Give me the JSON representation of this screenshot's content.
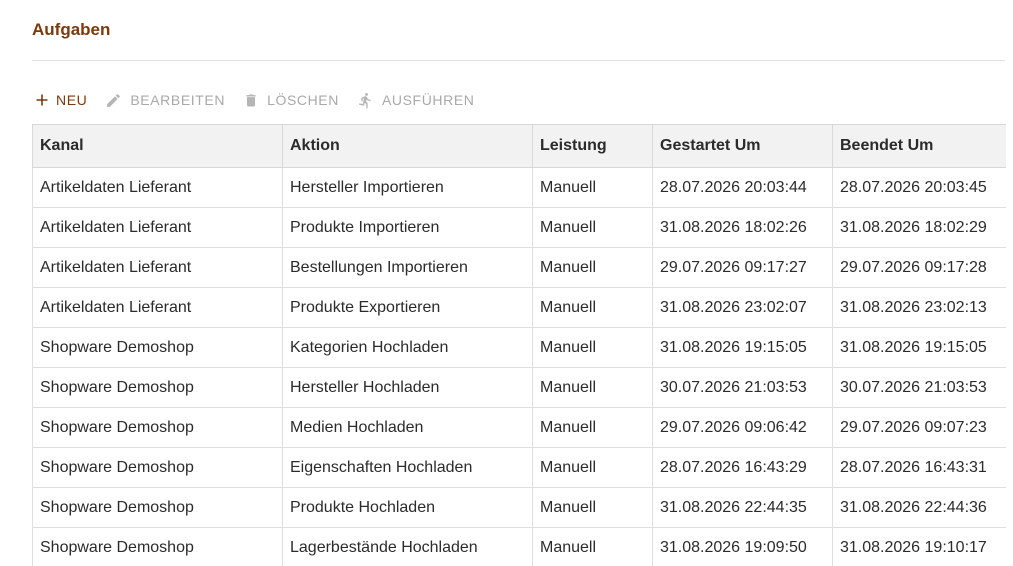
{
  "page": {
    "title": "Aufgaben"
  },
  "toolbar": {
    "new_label": "NEU",
    "edit_label": "BEARBEITEN",
    "delete_label": "LÖSCHEN",
    "run_label": "AUSFÜHREN"
  },
  "colors": {
    "accent": "#7a3a0c",
    "disabled": "#a9a9a9",
    "header_bg": "#f2f2f2"
  },
  "table": {
    "columns": [
      "Kanal",
      "Aktion",
      "Leistung",
      "Gestartet Um",
      "Beendet Um"
    ],
    "rows": [
      [
        "Artikeldaten Lieferant",
        "Hersteller Importieren",
        "Manuell",
        "28.07.2026 20:03:44",
        "28.07.2026 20:03:45"
      ],
      [
        "Artikeldaten Lieferant",
        "Produkte Importieren",
        "Manuell",
        "31.08.2026 18:02:26",
        "31.08.2026 18:02:29"
      ],
      [
        "Artikeldaten Lieferant",
        "Bestellungen Importieren",
        "Manuell",
        "29.07.2026 09:17:27",
        "29.07.2026 09:17:28"
      ],
      [
        "Artikeldaten Lieferant",
        "Produkte Exportieren",
        "Manuell",
        "31.08.2026 23:02:07",
        "31.08.2026 23:02:13"
      ],
      [
        "Shopware Demoshop",
        "Kategorien Hochladen",
        "Manuell",
        "31.08.2026 19:15:05",
        "31.08.2026 19:15:05"
      ],
      [
        "Shopware Demoshop",
        "Hersteller Hochladen",
        "Manuell",
        "30.07.2026 21:03:53",
        "30.07.2026 21:03:53"
      ],
      [
        "Shopware Demoshop",
        "Medien Hochladen",
        "Manuell",
        "29.07.2026 09:06:42",
        "29.07.2026 09:07:23"
      ],
      [
        "Shopware Demoshop",
        "Eigenschaften Hochladen",
        "Manuell",
        "28.07.2026 16:43:29",
        "28.07.2026 16:43:31"
      ],
      [
        "Shopware Demoshop",
        "Produkte Hochladen",
        "Manuell",
        "31.08.2026 22:44:35",
        "31.08.2026 22:44:36"
      ],
      [
        "Shopware Demoshop",
        "Lagerbestände Hochladen",
        "Manuell",
        "31.08.2026 19:09:50",
        "31.08.2026 19:10:17"
      ]
    ]
  }
}
